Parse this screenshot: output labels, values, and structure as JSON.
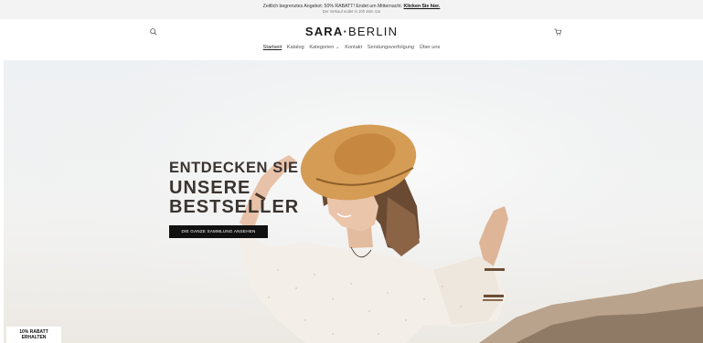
{
  "announcement": {
    "text": "Zeitlich begrenztes Angebot: 50% RABATT! Endet um Mitternacht.",
    "link": "Klicken Sie hier.",
    "countdown": "Der Verkauf endet in 10h 46m 41s"
  },
  "header": {
    "logo_bold": "SARA",
    "logo_sep": "·",
    "logo_light": "BERLIN",
    "search_icon": "search-icon",
    "cart_icon": "cart-icon"
  },
  "nav": {
    "items": [
      "Startseit",
      "Katalog",
      "Kategorien ⌄",
      "Kontakt",
      "Sendungsverfolgung",
      "Über uns"
    ]
  },
  "hero": {
    "title_line1": "ENTDECKEN SIE",
    "title_line2": "UNSERE",
    "title_line3": "BESTSELLER",
    "cta": "DIE GANZE SAMMLUNG ANSEHEN"
  },
  "discount_badge": {
    "line1": "10% RABATT",
    "line2": "ERHALTEN"
  }
}
